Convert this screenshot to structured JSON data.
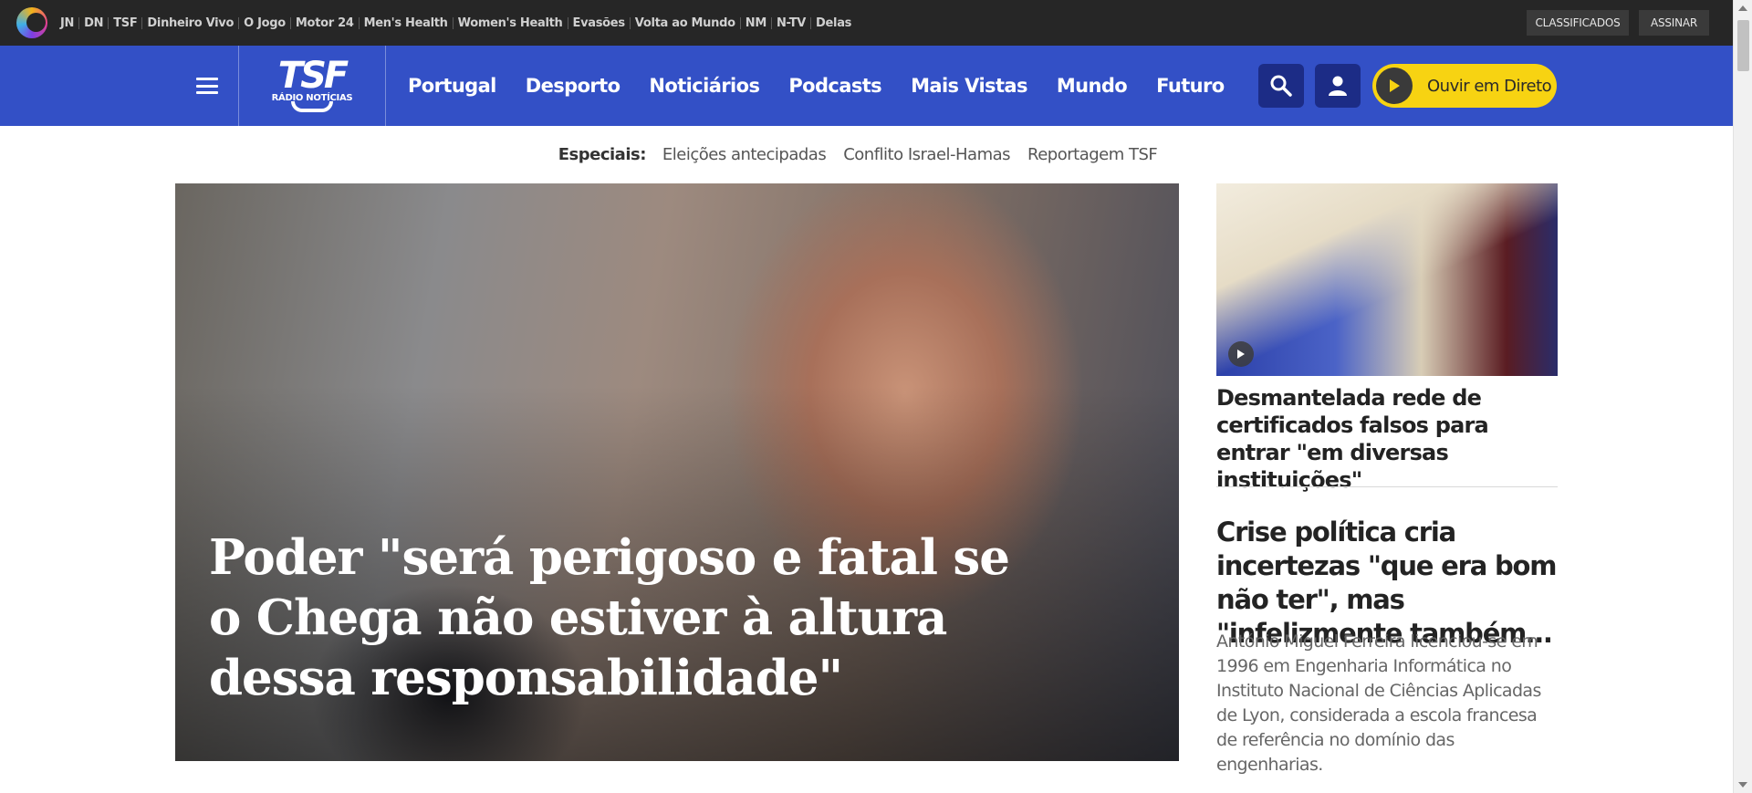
{
  "network_bar": {
    "links": [
      "JN",
      "DN",
      "TSF",
      "Dinheiro Vivo",
      "O Jogo",
      "Motor 24",
      "Men's Health",
      "Women's Health",
      "Evasões",
      "Volta ao Mundo",
      "NM",
      "N-TV",
      "Delas"
    ],
    "classificados": "CLASSIFICADOS",
    "assinar": "ASSINAR"
  },
  "header": {
    "logo_mark": "TSF",
    "logo_sub": "RÁDIO NOTÍCIAS",
    "nav": [
      "Portugal",
      "Desporto",
      "Noticiários",
      "Podcasts",
      "Mais Vistas",
      "Mundo",
      "Futuro"
    ],
    "live_label": "Ouvir em Direto",
    "brand_color": "#3350c6",
    "live_color": "#f7d312"
  },
  "specials": {
    "title": "Especiais:",
    "items": [
      "Eleições antecipadas",
      "Conflito Israel-Hamas",
      "Reportagem TSF"
    ]
  },
  "hero": {
    "title": "Poder \"será perigoso e fatal se o Chega não estiver à altura dessa responsabilidade\""
  },
  "side": {
    "article1_title": "Desmantelada rede de certificados falsos para entrar \"em diversas instituições\"",
    "article2_title": "Crise política cria incertezas \"que era bom não ter\", mas \"infelizmente também…",
    "article2_excerpt": "António Miguel Ferreira licenciou-se em 1996 em Engenharia Informática no Instituto Nacional de Ciências Aplicadas de Lyon, considerada a escola francesa de referência no domínio das engenharias."
  }
}
